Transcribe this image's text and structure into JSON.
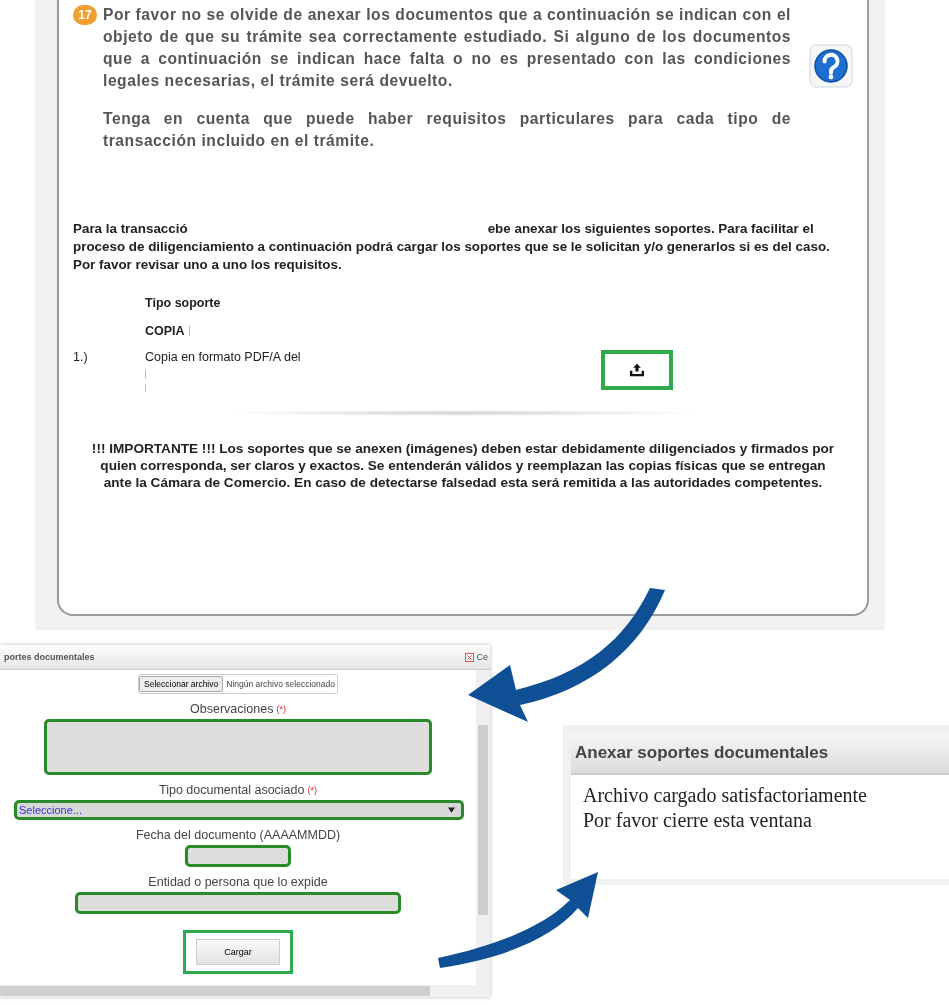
{
  "instructions_panel": {
    "step_badge": "17",
    "paragraphs": [
      "Por favor no se olvide de anexar los documentos que a continuación se indican con el objeto de que su trámite sea correctamente estudiado. Si alguno de los documentos que a continuación se indican hace falta o no es presentado con las condiciones legales necesarias, el trámite será devuelto.",
      "Tenga en cuenta que puede haber requisitos particulares para cada tipo de transacción incluido en el trámite."
    ],
    "transaction_text_start": "Para la transacció",
    "transaction_text_rest": "ebe anexar los siguientes soportes. Para facilitar el proceso de diligenciamiento a continuación podrá cargar los soportes que se le solicitan y/o generarlos si es del caso. Por favor revisar uno a uno los requisitos.",
    "support_table": {
      "column_header": "Tipo soporte",
      "group": "COPIA",
      "rows": [
        {
          "number": "1.)",
          "description": "Copia en formato PDF/A del"
        }
      ]
    },
    "important_notice": "!!! IMPORTANTE !!! Los soportes que se anexen (imágenes) deben estar debidamente diligenciados y firmados por quien corresponda, ser claros y exactos. Se entenderán válidos y reemplazan las copias físicas que se entregan ante la Cámara de Comercio. En caso de detectarse falsedad esta será remitida a las autoridades competentes."
  },
  "upload_dialog": {
    "title": "portes documentales",
    "close_label": "Ce",
    "file_button": "Seleccionar archivo",
    "file_status": "Ningún archivo seleccionado",
    "fields": [
      {
        "kind": "textarea",
        "label": "Observaciones",
        "required_mark": "(*)"
      },
      {
        "kind": "select",
        "label": "Tipo documental asociado",
        "required_mark": "(*)",
        "value": "Seleccione..."
      },
      {
        "kind": "short",
        "label": "Fecha del documento (AAAAMMDD)"
      },
      {
        "kind": "wide",
        "label": "Entidad o persona que lo expide"
      }
    ],
    "submit_button": "Cargar"
  },
  "success_dialog": {
    "title": "Anexar soportes documentales",
    "lines": [
      "Archivo cargado satisfactoriamente",
      "Por favor cierre esta ventana"
    ]
  }
}
